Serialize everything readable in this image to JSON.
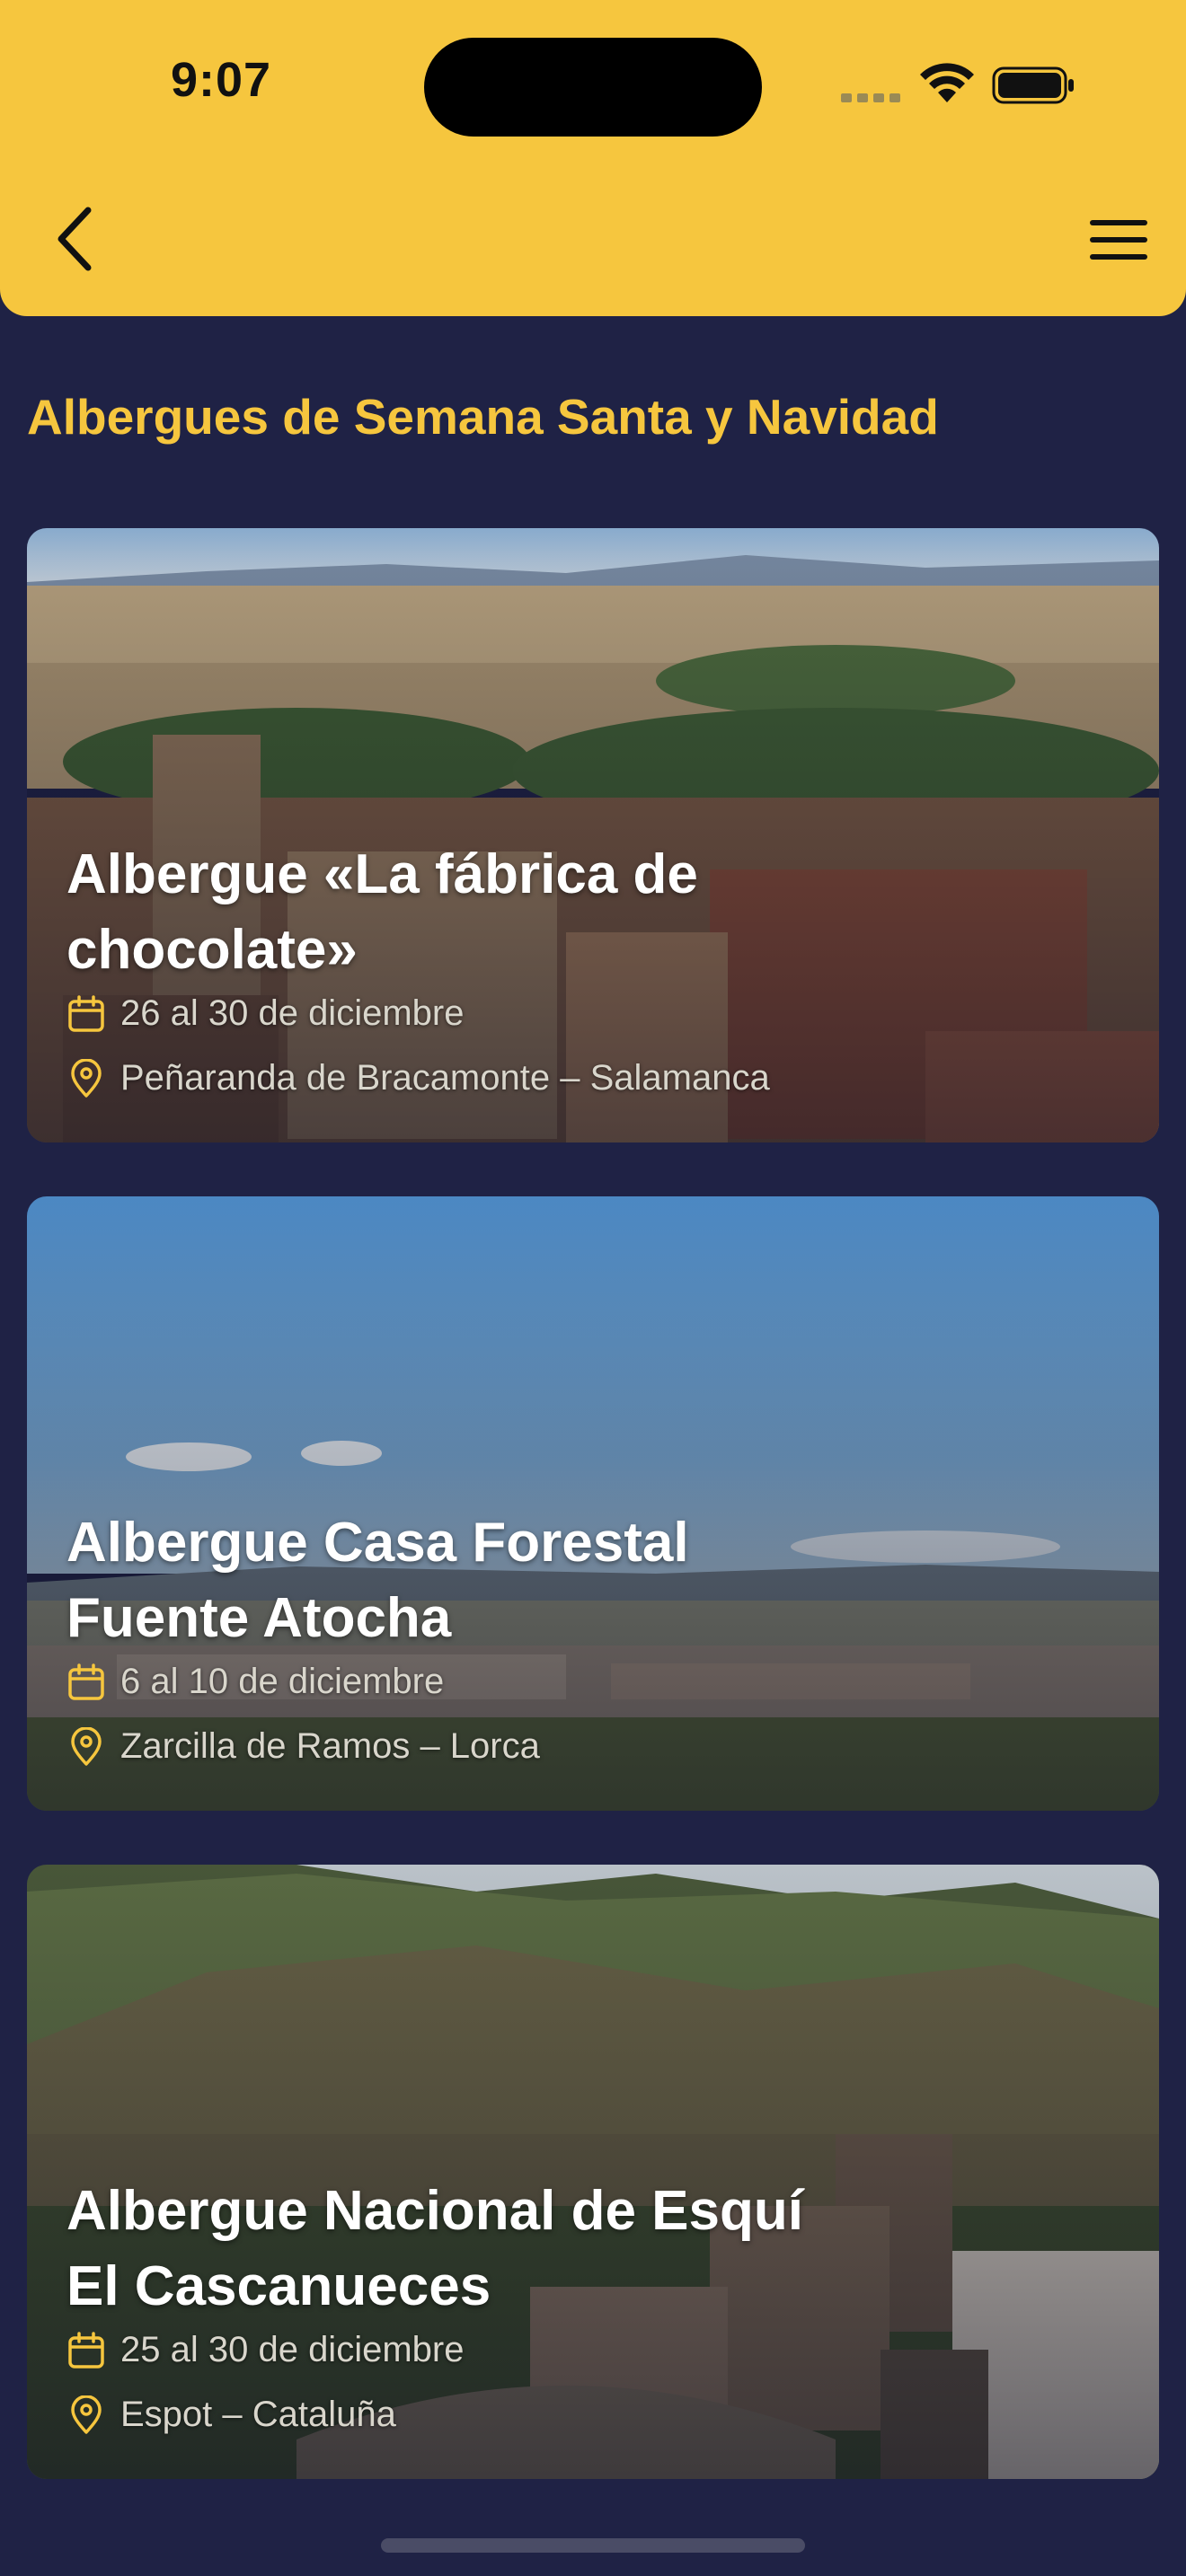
{
  "status_bar": {
    "time": "9:07"
  },
  "header": {
    "back_icon": "chevron-left-icon",
    "menu_icon": "hamburger-menu-icon"
  },
  "section": {
    "title": "Albergues de Semana Santa y Navidad"
  },
  "cards": [
    {
      "title_line1": "Albergue «La fábrica de",
      "title_line2": "chocolate»",
      "dates": "26 al 30 de diciembre",
      "location": "Peñaranda de Bracamonte – Salamanca"
    },
    {
      "title_line1": "Albergue Casa Forestal",
      "title_line2": "Fuente Atocha",
      "dates": "6 al 10 de diciembre",
      "location": "Zarcilla de Ramos – Lorca"
    },
    {
      "title_line1": "Albergue Nacional de Esquí",
      "title_line2": "El Cascanueces",
      "dates": "25 al 30 de diciembre",
      "location": "Espot – Cataluña"
    }
  ],
  "colors": {
    "accent": "#f6c63e",
    "background": "#1f2245",
    "meta_text": "#d9d6cc"
  },
  "icons": {
    "date": "calendar-icon",
    "location": "map-pin-icon"
  }
}
